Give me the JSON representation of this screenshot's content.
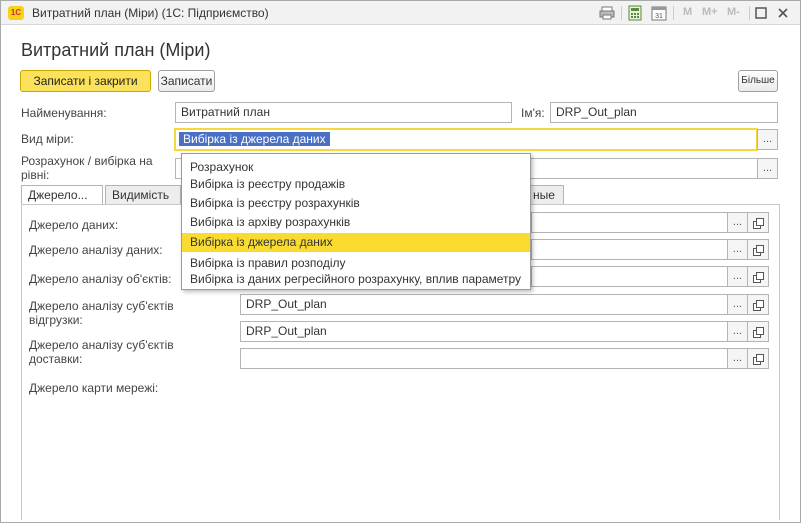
{
  "window": {
    "title": "Витратний план (Міри) (1С: Підприємство)",
    "logo": "1c",
    "toolbar": {
      "m": "M",
      "m_plus": "M+",
      "m_minus": "M-"
    }
  },
  "form": {
    "title": "Витратний план (Міри)",
    "buttons": {
      "save_close": "Записати і закрити",
      "save": "Записати",
      "more": "Більше"
    },
    "fields": {
      "name_label": "Найменування:",
      "name_value": "Витратний план",
      "id_label": "Ім'я:",
      "id_value": "DRP_Out_plan",
      "measure_type_label": "Вид міри:",
      "measure_type_value": "Вибірка із джерела даних",
      "calc_level_label": "Розрахунок / вибірка на рівні:",
      "calc_level_value": ""
    },
    "tabs": [
      {
        "label": "Джерело..."
      },
      {
        "label": "Видимість"
      },
      {
        "label": "ные"
      }
    ],
    "source": {
      "data_source_label": "Джерело даних:",
      "analysis_source_label": "Джерело аналізу даних:",
      "objects_source_label": "Джерело аналізу об'єктів:",
      "shipping_subjects_label": "Джерело аналізу суб'єктів відгрузки:",
      "shipping_subjects_value": "DRP_Out_plan",
      "delivery_subjects_value": "DRP_Out_plan",
      "delivery_subjects_label": "Джерело аналізу суб'єктів доставки:",
      "delivery_subjects_value2": "",
      "network_map_label": "Джерело карти мережі:"
    },
    "choice_button": "...",
    "dropdown": {
      "items": [
        "Розрахунок",
        "Вибірка із реєстру продажів",
        "Вибірка із реєстру розрахунків",
        "Вибірка із архіву розрахунків",
        "Вибірка із джерела даних",
        "Вибірка із правил розподілу",
        "Вибірка із даних регресійного розрахунку, вплив параметру"
      ],
      "selected_index": 4
    }
  },
  "colors": {
    "accent_yellow": "#fbe25a",
    "selection_yellow": "#f9dc2f",
    "selection_blue": "#4a6fc4"
  }
}
